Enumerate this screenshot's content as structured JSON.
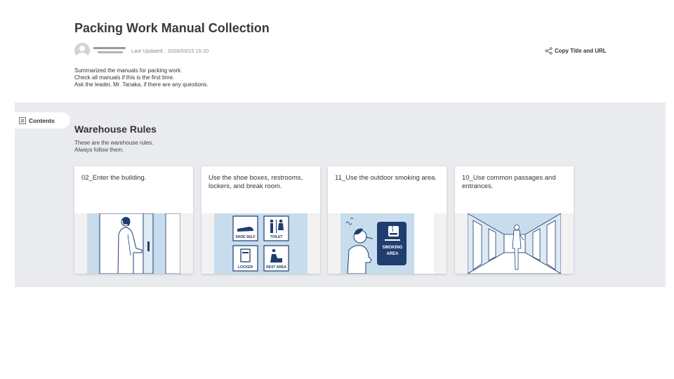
{
  "page": {
    "title": "Packing Work Manual Collection",
    "last_updated_label": "Last Updated :",
    "last_updated_value": "2026/03/23 15:20",
    "copy_link_label": "Copy Title and URL",
    "description": [
      "Summarized the manuals for packing work.",
      "Check all manuals if this is the first time.",
      "Ask the leader, Mr. Tanaka, if there are any questions."
    ]
  },
  "contents_tab": {
    "label": "Contents"
  },
  "section": {
    "title": "Warehouse Rules",
    "description": [
      "These are the warehouse rules.",
      "Always follow them."
    ],
    "cards": [
      {
        "title": "02_Enter the building."
      },
      {
        "title": "Use the shoe boxes, restrooms, lockers, and break room."
      },
      {
        "title": "11_Use the outdoor smoking area."
      },
      {
        "title": "10_Use common passages and entrances."
      }
    ],
    "illustration_labels": {
      "shoe_shelf": "SHOE SELF",
      "toilet": "TOILET",
      "locker": "LOCKER",
      "rest_area": "REST AREA",
      "smoking_line1": "SMOKING",
      "smoking_line2": "AREA"
    }
  },
  "colors": {
    "section_background": "#e9ebef",
    "illustration_blue": "#c7dcec",
    "illustration_navy": "#1f3d6e"
  },
  "icons": [
    "user-avatar-icon",
    "share-icon",
    "list-icon"
  ]
}
